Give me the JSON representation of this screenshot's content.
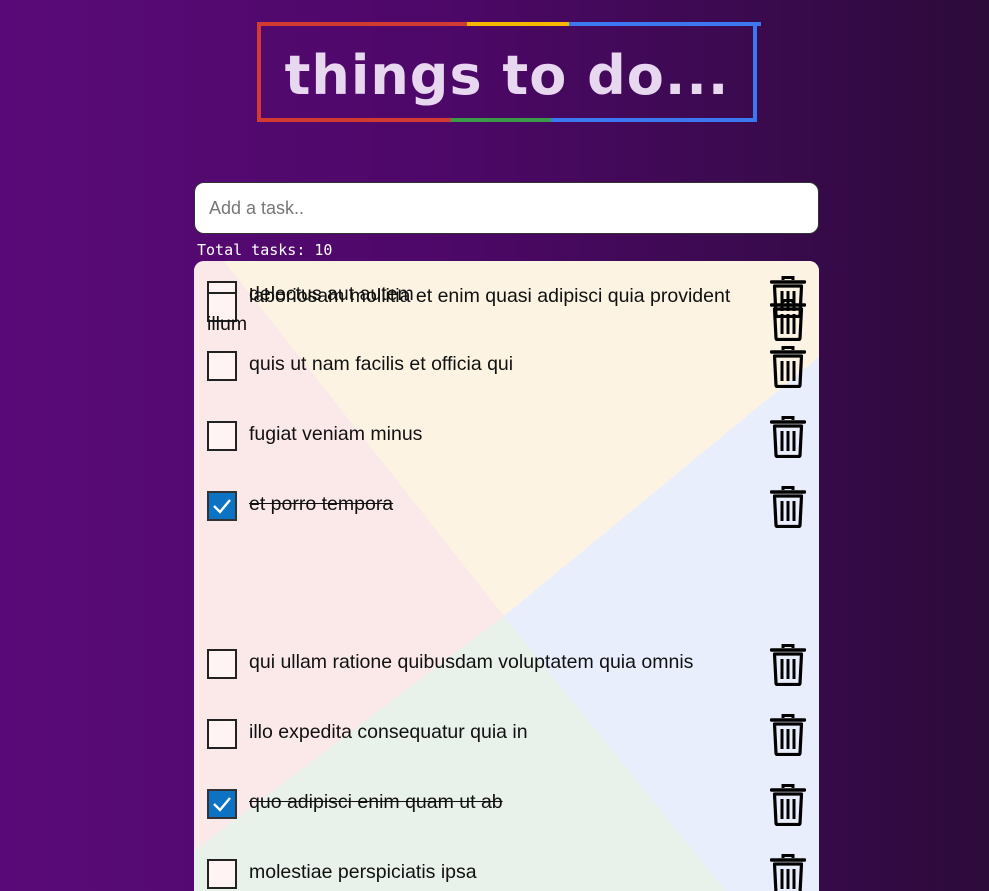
{
  "header": {
    "title": "things to do..."
  },
  "input": {
    "placeholder": "Add a task..",
    "value": ""
  },
  "summary": {
    "total": "Total tasks: 10"
  },
  "colors": {
    "checked": "#0b72c4",
    "title_border_red": "#d23b32",
    "title_border_yellow": "#f5b800",
    "title_border_green": "#3a9a4a",
    "title_border_blue": "#3c78f0"
  },
  "tasks": [
    {
      "text": "delectus aut autem",
      "completed": false
    },
    {
      "text": "quis ut nam facilis et officia qui",
      "completed": false
    },
    {
      "text": "fugiat veniam minus",
      "completed": false
    },
    {
      "text": "et porro tempora",
      "completed": true
    },
    {
      "text": "laboriosam mollitia et enim quasi adipisci quia provident illum",
      "completed": false
    },
    {
      "text": "qui ullam ratione quibusdam voluptatem quia omnis",
      "completed": false
    },
    {
      "text": "illo expedita consequatur quia in",
      "completed": false
    },
    {
      "text": "quo adipisci enim quam ut ab",
      "completed": true
    },
    {
      "text": "molestiae perspiciatis ipsa",
      "completed": false
    }
  ],
  "icons": {
    "checkbox_mark": "checkmark-icon",
    "delete": "trash-icon"
  }
}
